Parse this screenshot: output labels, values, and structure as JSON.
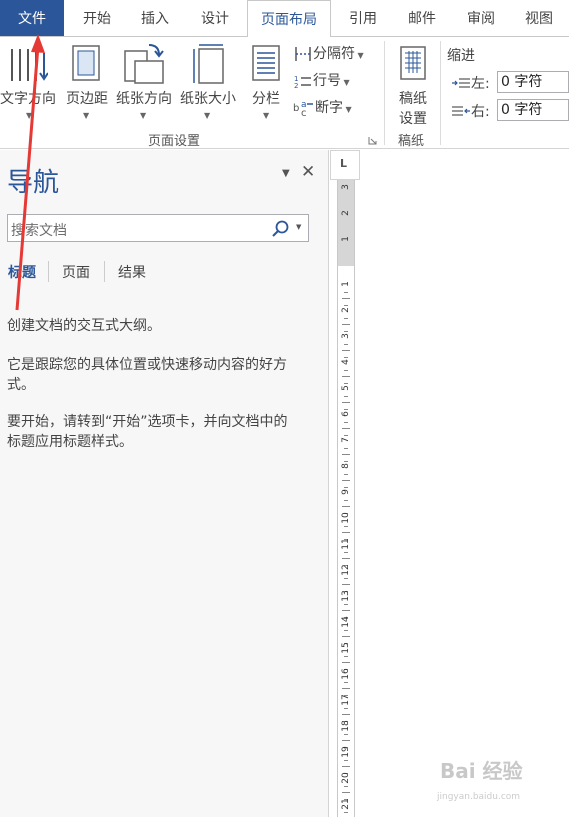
{
  "tabs": [
    {
      "label": "文件",
      "kind": "file"
    },
    {
      "label": "开始",
      "kind": "normal"
    },
    {
      "label": "插入",
      "kind": "normal"
    },
    {
      "label": "设计",
      "kind": "normal"
    },
    {
      "label": "页面布局",
      "kind": "active"
    },
    {
      "label": "引用",
      "kind": "normal"
    },
    {
      "label": "邮件",
      "kind": "normal"
    },
    {
      "label": "审阅",
      "kind": "normal"
    },
    {
      "label": "视图",
      "kind": "normal"
    }
  ],
  "ribbon": {
    "page_setup": {
      "text_direction": "文字方向",
      "margins": "页边距",
      "orientation": "纸张方向",
      "size": "纸张大小",
      "columns": "分栏",
      "breaks": "分隔符",
      "line_numbers": "行号",
      "hyphenation": "断字",
      "group_label": "页面设置"
    },
    "manuscript": {
      "button_line1": "稿纸",
      "button_line2": "设置",
      "group_label": "稿纸"
    },
    "indent": {
      "title": "缩进",
      "left_label": "左:",
      "left_value": "0 字符",
      "right_label": "右:",
      "right_value": "0 字符"
    }
  },
  "nav": {
    "title": "导航",
    "search_placeholder": "搜索文档",
    "tabs": [
      "标题",
      "页面",
      "结果"
    ],
    "line1": "创建文档的交互式大纲。",
    "line2a": "它是跟踪您的具体位置或快速移动内容的好方",
    "line2b": "式。",
    "line3a": "要开始，请转到“开始”选项卡，并向文档中的",
    "line3b": "标题应用标题样式。"
  },
  "ruler": {
    "corner_symbol": "L",
    "top_margin_numbers": [
      "3",
      "2",
      "1"
    ],
    "body_numbers": [
      "1",
      "2",
      "3",
      "4",
      "5",
      "6",
      "7",
      "8",
      "9",
      "10",
      "11",
      "12",
      "13",
      "14",
      "15",
      "16",
      "17",
      "18",
      "19",
      "20",
      "21"
    ]
  },
  "watermark": {
    "text": "Bai 经验",
    "sub": "jingyan.baidu.com"
  },
  "colors": {
    "accent": "#2b579a",
    "annotation_arrow": "#e53935"
  }
}
